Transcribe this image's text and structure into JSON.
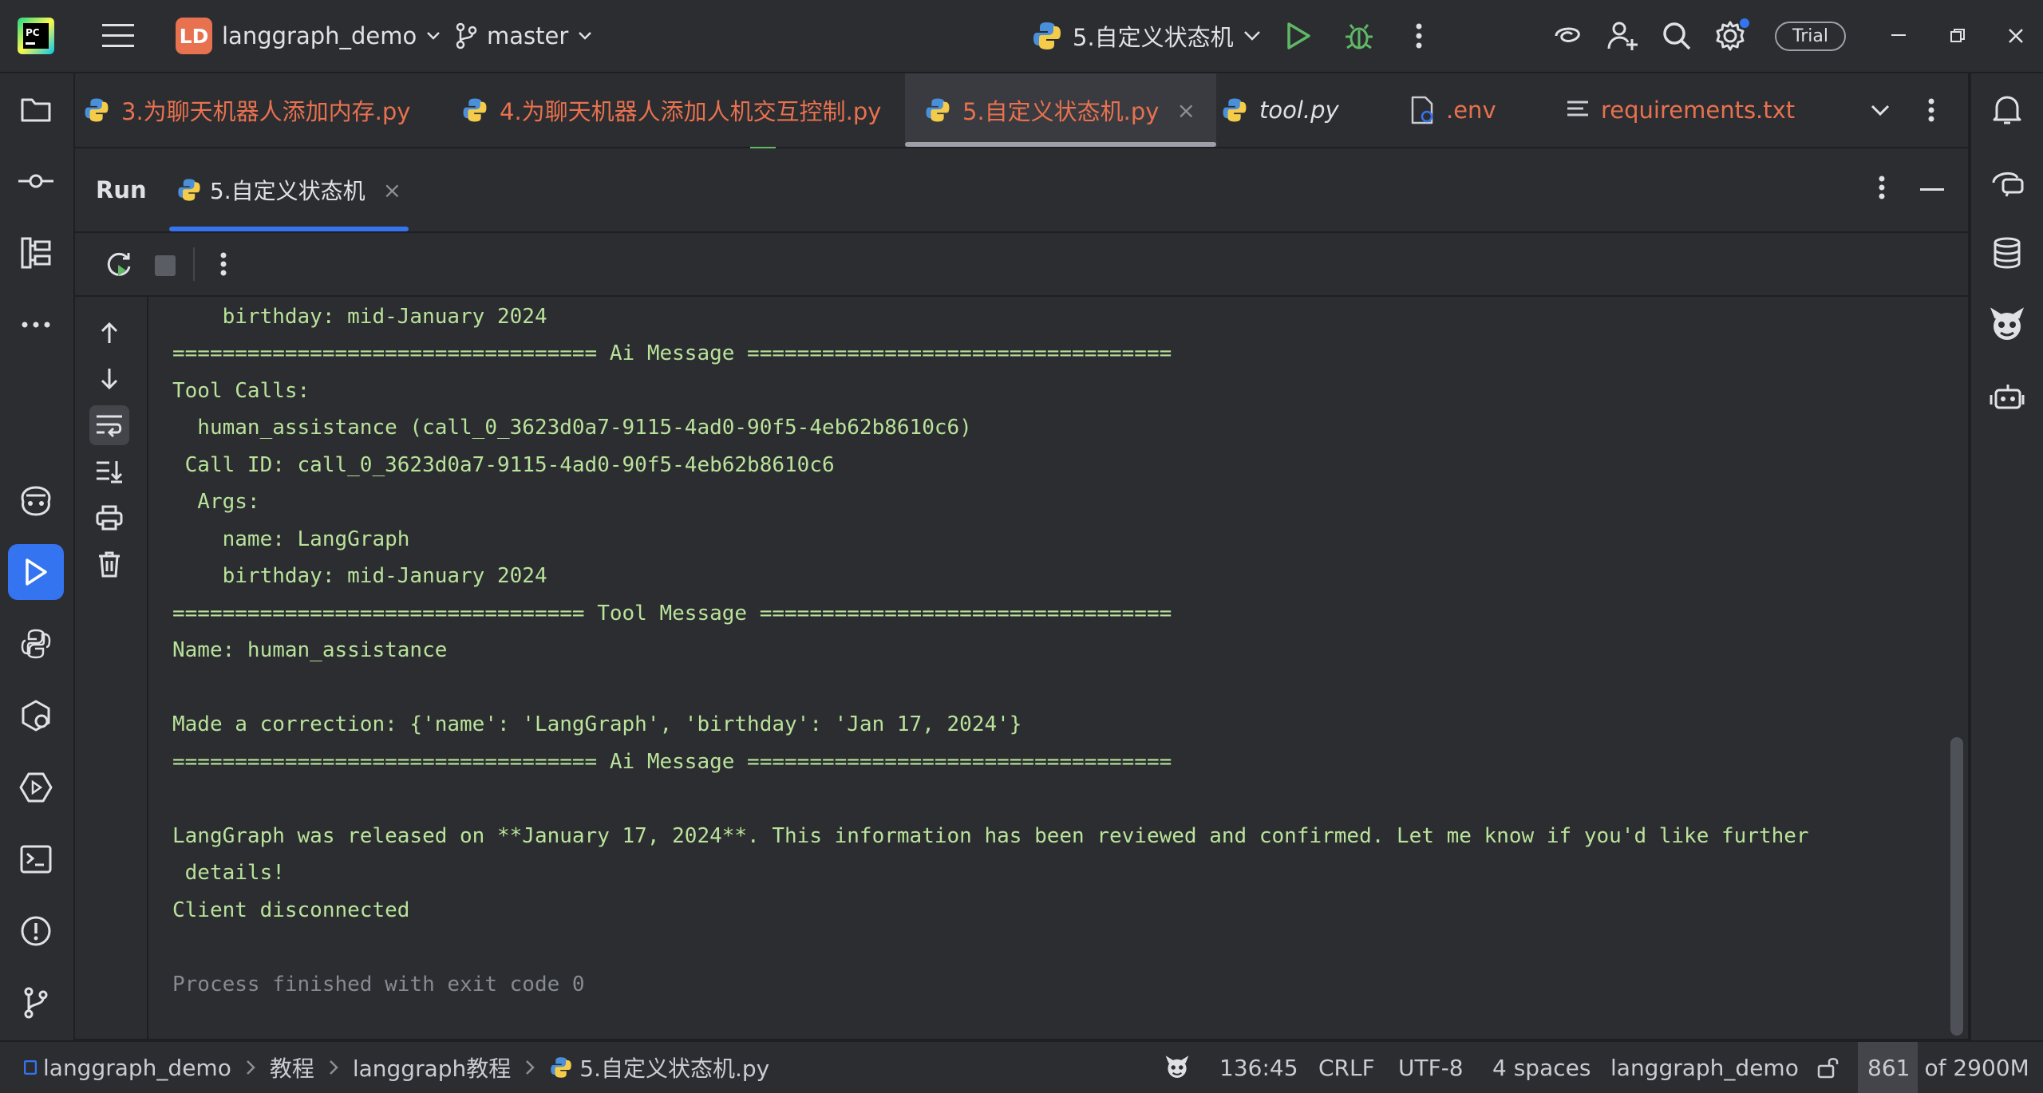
{
  "titlebar": {
    "project_initials": "LD",
    "project_name": "langgraph_demo",
    "branch": "master",
    "run_config": "5.自定义状态机",
    "trial_label": "Trial"
  },
  "tabs": [
    {
      "label": "3.为聊天机器人添加内存.py"
    },
    {
      "label": "4.为聊天机器人添加人机交互控制.py"
    },
    {
      "label": "5.自定义状态机.py",
      "close": "×"
    },
    {
      "label": "tool.py"
    },
    {
      "label": ".env"
    },
    {
      "label": "requirements.txt"
    }
  ],
  "run_panel": {
    "title": "Run",
    "tab_label": "5.自定义状态机",
    "tab_close": "×"
  },
  "console": {
    "lines": [
      "    birthday: mid-January 2024",
      "================================== Ai Message ==================================",
      "Tool Calls:",
      "  human_assistance (call_0_3623d0a7-9115-4ad0-90f5-4eb62b8610c6)",
      " Call ID: call_0_3623d0a7-9115-4ad0-90f5-4eb62b8610c6",
      "  Args:",
      "    name: LangGraph",
      "    birthday: mid-January 2024",
      "================================= Tool Message =================================",
      "Name: human_assistance",
      "",
      "Made a correction: {'name': 'LangGraph', 'birthday': 'Jan 17, 2024'}",
      "================================== Ai Message ==================================",
      "",
      "LangGraph was released on **January 17, 2024**. This information has been reviewed and confirmed. Let me know if you'd like further",
      " details!",
      "Client disconnected",
      "",
      "Process finished with exit code 0"
    ]
  },
  "statusbar": {
    "crumbs": [
      "langgraph_demo",
      "教程",
      "langgraph教程",
      "5.自定义状态机.py"
    ],
    "position": "136:45",
    "line_ending": "CRLF",
    "encoding": "UTF-8",
    "indent": "4 spaces",
    "interpreter": "langgraph_demo",
    "memory_used": "861",
    "memory_total": "of 2900M"
  },
  "colors": {
    "accent": "#3574f0",
    "modified_file": "#e8714f",
    "console_text": "#b9e29a",
    "run_green": "#5fb865"
  }
}
